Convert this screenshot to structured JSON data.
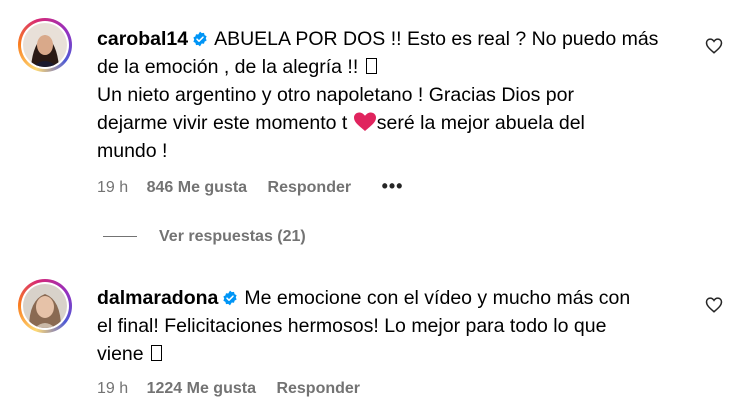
{
  "comments": [
    {
      "username": "carobal14",
      "verified": true,
      "text_line1": "ABUELA POR DOS !! Esto es real ? No puedo más",
      "text_line2": "de la emoción , de la alegría !!",
      "text_line3": "Un nieto argentino y otro napoletano ! Gracias Dios por",
      "text_line4a": "dejarme vivir este momento t",
      "text_line4b": "seré la mejor abuela del",
      "text_line5": "mundo !",
      "time": "19 h",
      "likes": "846 Me gusta",
      "reply_label": "Responder",
      "more_label": "•••",
      "view_replies": "Ver respuestas (21)"
    },
    {
      "username": "dalmaradona",
      "verified": true,
      "text_line1": "Me emocione con el vídeo y mucho más con",
      "text_line2": "el final! Felicitaciones hermosos! Lo mejor para todo lo que",
      "text_line3": "viene",
      "time": "19 h",
      "likes": "1224 Me gusta",
      "reply_label": "Responder"
    }
  ],
  "colors": {
    "verified_badge": "#0095f6",
    "meta_text": "#737373",
    "heart_emoji": "#e0245e"
  },
  "icons": {
    "like": "heart-outline-icon",
    "verified": "verified-badge-icon",
    "more": "more-options-icon"
  }
}
